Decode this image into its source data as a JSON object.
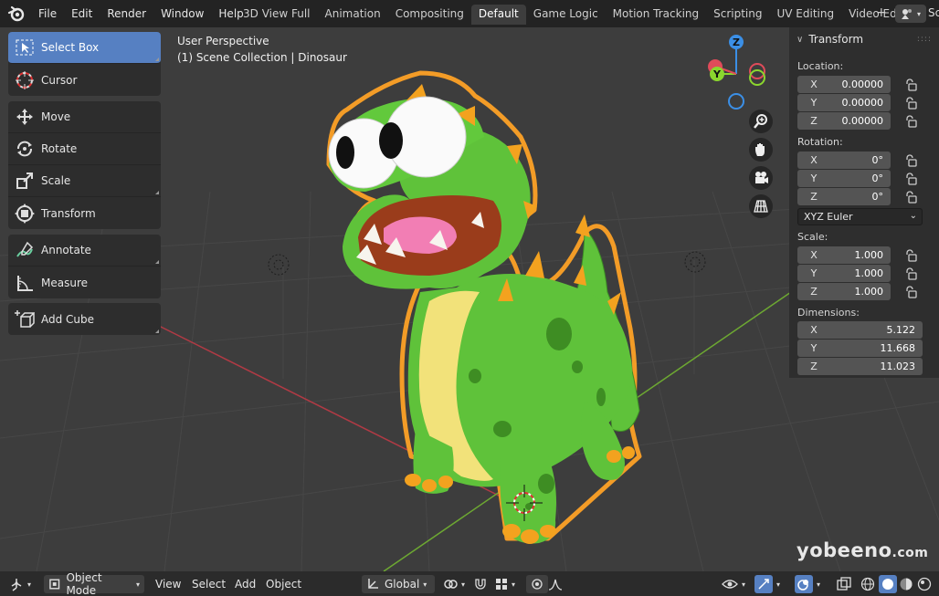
{
  "topbar": {
    "menu": [
      "File",
      "Edit",
      "Render",
      "Window",
      "Help"
    ],
    "workspaces": [
      {
        "label": "3D View Full",
        "active": false
      },
      {
        "label": "Animation",
        "active": false
      },
      {
        "label": "Compositing",
        "active": false
      },
      {
        "label": "Default",
        "active": true
      },
      {
        "label": "Game Logic",
        "active": false
      },
      {
        "label": "Motion Tracking",
        "active": false
      },
      {
        "label": "Scripting",
        "active": false
      },
      {
        "label": "UV Editing",
        "active": false
      },
      {
        "label": "Video Editing",
        "active": false
      }
    ],
    "add_icon": "+",
    "scene_label": "Sc"
  },
  "viewport": {
    "view_name": "User Perspective",
    "collection_info": "(1) Scene Collection | Dinosaur"
  },
  "toolbar": {
    "groups": [
      [
        {
          "label": "Select Box",
          "icon": "select-box-icon",
          "active": true
        },
        {
          "label": "Cursor",
          "icon": "cursor-icon",
          "active": false
        }
      ],
      [
        {
          "label": "Move",
          "icon": "move-icon",
          "active": false
        },
        {
          "label": "Rotate",
          "icon": "rotate-icon",
          "active": false
        },
        {
          "label": "Scale",
          "icon": "scale-icon",
          "active": false
        },
        {
          "label": "Transform",
          "icon": "transform-icon",
          "active": false
        }
      ],
      [
        {
          "label": "Annotate",
          "icon": "annotate-icon",
          "active": false
        },
        {
          "label": "Measure",
          "icon": "measure-icon",
          "active": false
        }
      ],
      [
        {
          "label": "Add Cube",
          "icon": "add-cube-icon",
          "active": false
        }
      ]
    ]
  },
  "gizmo": {
    "x": "",
    "y": "Y",
    "z": "Z"
  },
  "panel": {
    "title": "Transform",
    "location_label": "Location:",
    "location": [
      {
        "axis": "X",
        "value": "0.00000"
      },
      {
        "axis": "Y",
        "value": "0.00000"
      },
      {
        "axis": "Z",
        "value": "0.00000"
      }
    ],
    "rotation_label": "Rotation:",
    "rotation": [
      {
        "axis": "X",
        "value": "0°"
      },
      {
        "axis": "Y",
        "value": "0°"
      },
      {
        "axis": "Z",
        "value": "0°"
      }
    ],
    "rotation_mode": "XYZ Euler",
    "scale_label": "Scale:",
    "scale": [
      {
        "axis": "X",
        "value": "1.000"
      },
      {
        "axis": "Y",
        "value": "1.000"
      },
      {
        "axis": "Z",
        "value": "1.000"
      }
    ],
    "dimensions_label": "Dimensions:",
    "dimensions": [
      {
        "axis": "X",
        "value": "5.122"
      },
      {
        "axis": "Y",
        "value": "11.668"
      },
      {
        "axis": "Z",
        "value": "11.023"
      }
    ]
  },
  "watermark": {
    "main": "yobeeno",
    "suffix": ".com"
  },
  "bottombar": {
    "mode": "Object Mode",
    "menus": [
      "View",
      "Select",
      "Add",
      "Object"
    ],
    "orientation": "Global"
  },
  "colors": {
    "accent": "#5680c2",
    "dino_green": "#5fc23a",
    "dino_belly": "#f2e27a",
    "dino_spikes": "#f3a21f",
    "selection_outline": "#f39c27",
    "axis_x": "#e04b5a",
    "axis_y": "#8bd62e",
    "axis_z": "#3b8fe6"
  }
}
